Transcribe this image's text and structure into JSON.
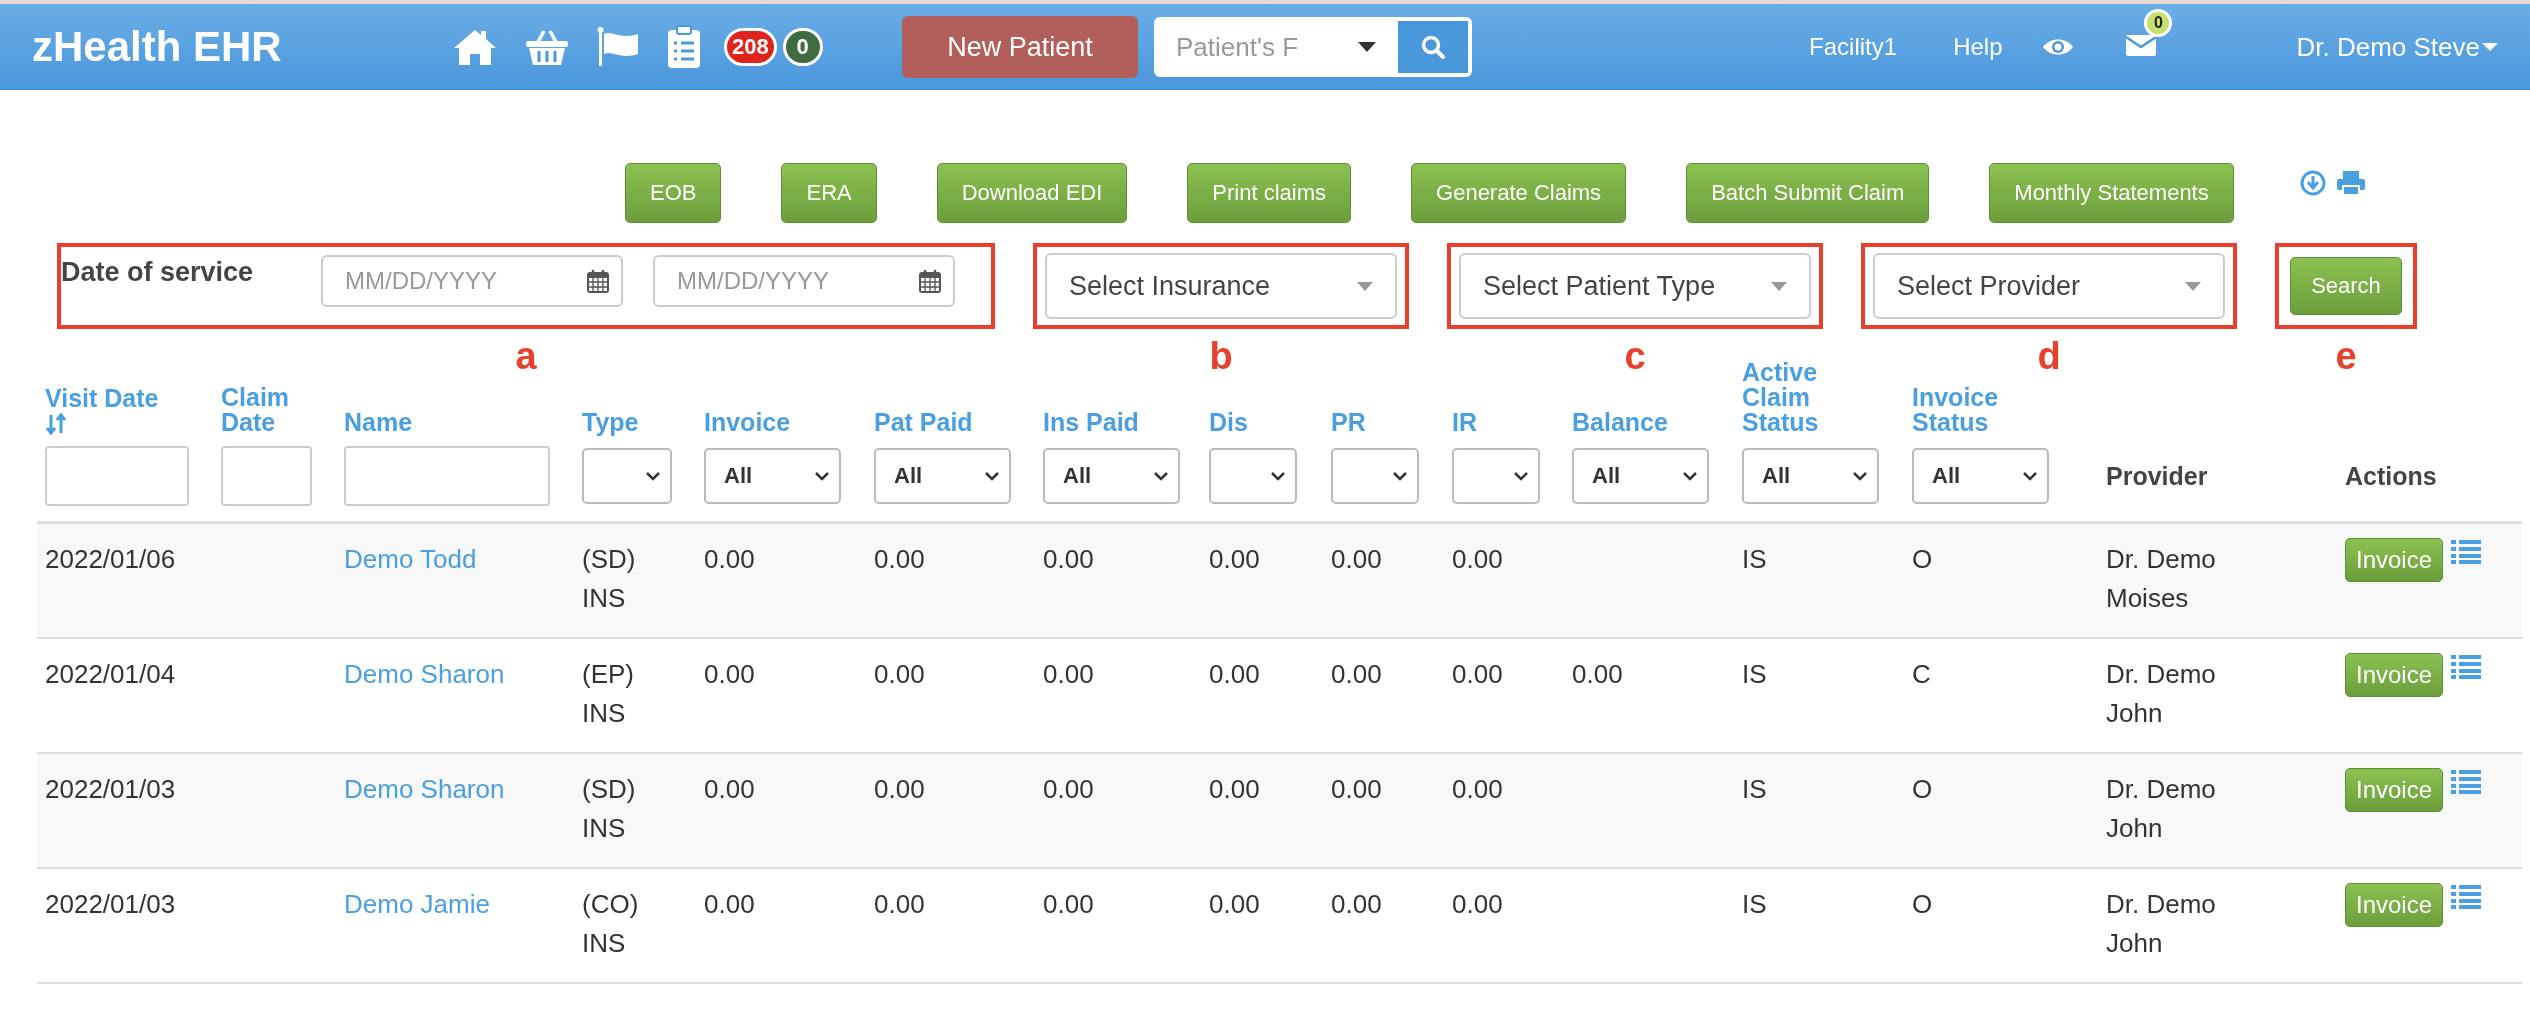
{
  "header": {
    "brand": "zHealth EHR",
    "badges": [
      {
        "count": "208",
        "color": "#e0231c"
      },
      {
        "count": "0",
        "color": "#3e6b40"
      }
    ],
    "new_patient_button": "New Patient",
    "patient_search": {
      "placeholder": "Patient's F"
    },
    "facility": "Facility1",
    "help": "Help",
    "mail_badge": "0",
    "user": "Dr. Demo Steve"
  },
  "toolbar": [
    "EOB",
    "ERA",
    "Download EDI",
    "Print claims",
    "Generate Claims",
    "Batch Submit Claim",
    "Monthly Statements"
  ],
  "filters": {
    "date_label": "Date of service",
    "date_fields": [
      {
        "placeholder": "MM/DD/YYYY"
      },
      {
        "placeholder": "MM/DD/YYYY"
      }
    ],
    "selects": [
      {
        "placeholder": "Select Insurance"
      },
      {
        "placeholder": "Select Patient Type"
      },
      {
        "placeholder": "Select Provider"
      }
    ],
    "search_button": "Search"
  },
  "annotations": [
    "a",
    "b",
    "c",
    "d",
    "e"
  ],
  "table": {
    "columns": [
      {
        "label": "Visit Date",
        "sortable": true,
        "kind": "text"
      },
      {
        "label": "Claim Date",
        "kind": "text"
      },
      {
        "label": "Name",
        "kind": "text"
      },
      {
        "label": "Type",
        "kind": "select"
      },
      {
        "label": "Invoice",
        "kind": "select",
        "value": "All"
      },
      {
        "label": "Pat Paid",
        "kind": "select",
        "value": "All"
      },
      {
        "label": "Ins Paid",
        "kind": "select",
        "value": "All"
      },
      {
        "label": "Dis",
        "kind": "select"
      },
      {
        "label": "PR",
        "kind": "select"
      },
      {
        "label": "IR",
        "kind": "select"
      },
      {
        "label": "Balance",
        "kind": "select",
        "value": "All"
      },
      {
        "label": "Active Claim Status",
        "kind": "select",
        "value": "All"
      },
      {
        "label": "Invoice Status",
        "kind": "select",
        "value": "All"
      },
      {
        "label": "Provider",
        "kind": "plain"
      },
      {
        "label": "Actions",
        "kind": "plain"
      }
    ],
    "rows": [
      {
        "visit_date": "2022/01/06",
        "name": "Demo Todd",
        "type": "(SD) INS",
        "invoice": "0.00",
        "pat_paid": "0.00",
        "ins_paid": "0.00",
        "dis": "0.00",
        "pr": "0.00",
        "ir": "0.00",
        "claim_status": "IS",
        "invoice_status": "O",
        "provider": "Dr. Demo Moises",
        "action": "Invoice"
      },
      {
        "visit_date": "2022/01/04",
        "name": "Demo Sharon",
        "type": "(EP) INS",
        "invoice": "0.00",
        "pat_paid": "0.00",
        "ins_paid": "0.00",
        "dis": "0.00",
        "pr": "0.00",
        "ir": "0.00",
        "balance": "0.00",
        "claim_status": "IS",
        "invoice_status": "C",
        "provider": "Dr. Demo John",
        "action": "Invoice"
      },
      {
        "visit_date": "2022/01/03",
        "name": "Demo Sharon",
        "type": "(SD) INS",
        "invoice": "0.00",
        "pat_paid": "0.00",
        "ins_paid": "0.00",
        "dis": "0.00",
        "pr": "0.00",
        "ir": "0.00",
        "claim_status": "IS",
        "invoice_status": "O",
        "provider": "Dr. Demo John",
        "action": "Invoice"
      },
      {
        "visit_date": "2022/01/03",
        "name": "Demo Jamie",
        "type": "(CO) INS",
        "invoice": "0.00",
        "pat_paid": "0.00",
        "ins_paid": "0.00",
        "dis": "0.00",
        "pr": "0.00",
        "ir": "0.00",
        "claim_status": "IS",
        "invoice_status": "O",
        "provider": "Dr. Demo John",
        "action": "Invoice"
      }
    ]
  }
}
